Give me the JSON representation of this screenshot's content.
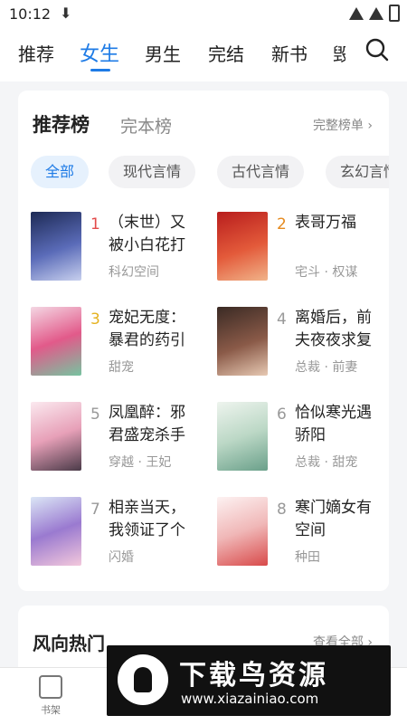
{
  "status": {
    "time": "10:12"
  },
  "tabs": [
    {
      "label": "推荐"
    },
    {
      "label": "女生"
    },
    {
      "label": "男生"
    },
    {
      "label": "完结"
    },
    {
      "label": "新书"
    },
    {
      "label": "毁"
    }
  ],
  "ranking": {
    "title": "推荐榜",
    "alt_title": "完本榜",
    "more": "完整榜单 ›",
    "chips": [
      "全部",
      "现代言情",
      "古代言情",
      "玄幻言情"
    ],
    "books": [
      {
        "rank": "1",
        "title": "（末世）又被小白花打",
        "tags": "科幻空间"
      },
      {
        "rank": "2",
        "title": "表哥万福",
        "tags": "宅斗 · 权谋"
      },
      {
        "rank": "3",
        "title": "宠妃无度：暴君的药引",
        "tags": "甜宠"
      },
      {
        "rank": "4",
        "title": "离婚后，前夫夜夜求复",
        "tags": "总裁 · 前妻"
      },
      {
        "rank": "5",
        "title": "凤凰醉：邪君盛宠杀手",
        "tags": "穿越 · 王妃"
      },
      {
        "rank": "6",
        "title": "恰似寒光遇骄阳",
        "tags": "总裁 · 甜宠"
      },
      {
        "rank": "7",
        "title": "相亲当天，我领证了个",
        "tags": "闪婚"
      },
      {
        "rank": "8",
        "title": "寒门嫡女有空间",
        "tags": "种田"
      }
    ]
  },
  "trending": {
    "title": "风向热门",
    "more": "查看全部 ›"
  },
  "bottom_nav": [
    {
      "label": "书架"
    }
  ],
  "watermark": {
    "title": "下载鸟资源",
    "url": "www.xiazainiao.com"
  },
  "colors": {
    "accent": "#1e7be6",
    "rank1": "#e34b4b",
    "rank2": "#e58a1f",
    "rank3": "#e5b21f"
  }
}
